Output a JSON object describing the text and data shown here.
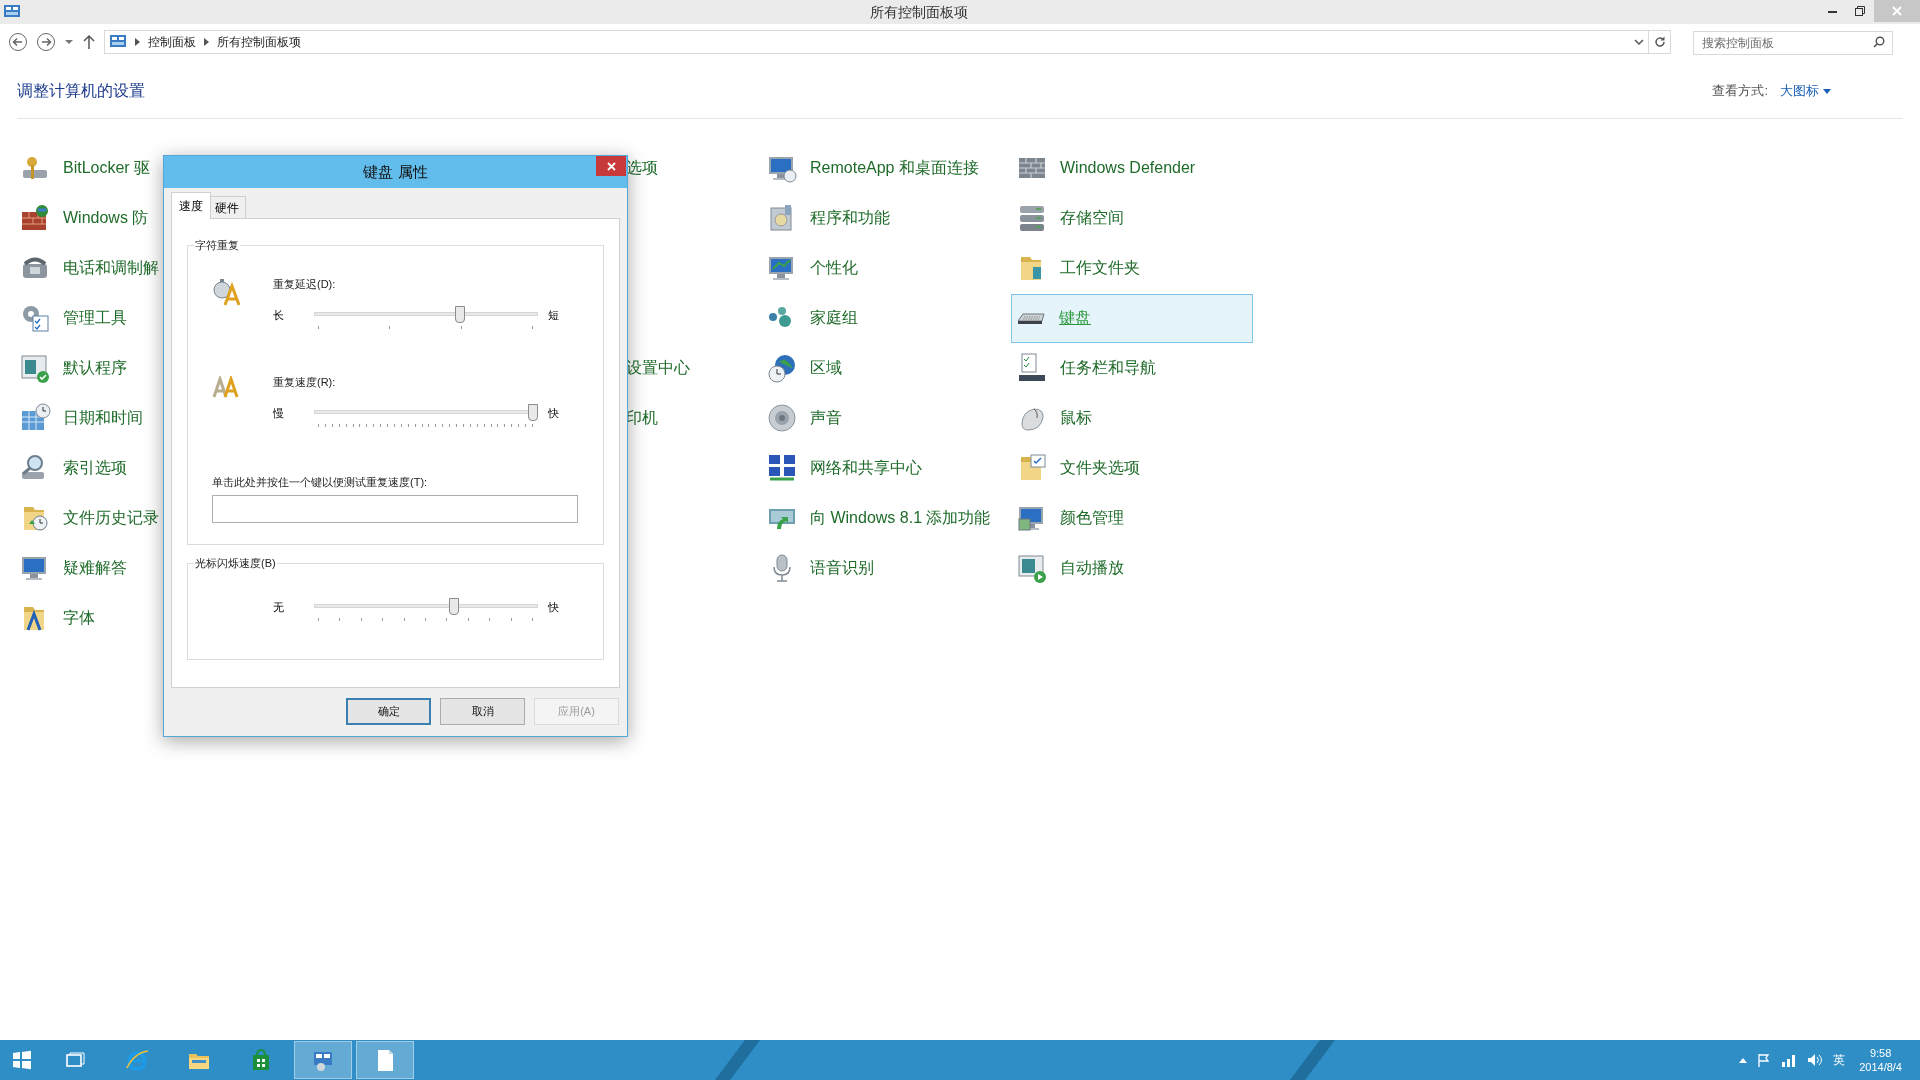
{
  "window": {
    "title": "所有控制面板项"
  },
  "address_bar": {
    "breadcrumbs": [
      "控制面板",
      "所有控制面板项"
    ]
  },
  "search": {
    "placeholder": "搜索控制面板"
  },
  "header": {
    "title": "调整计算机的设置",
    "view_label": "查看方式:",
    "view_value": "大图标"
  },
  "columns": [
    [
      {
        "label": "BitLocker 驱",
        "selected": false
      },
      {
        "label": "Windows 防",
        "selected": false
      },
      {
        "label": "电话和调制解",
        "selected": false
      },
      {
        "label": "管理工具",
        "selected": false
      },
      {
        "label": "默认程序",
        "selected": false
      },
      {
        "label": "日期和时间",
        "selected": false
      },
      {
        "label": "索引选项",
        "selected": false
      },
      {
        "label": "文件历史记录",
        "selected": false
      },
      {
        "label": "疑难解答",
        "selected": false
      },
      {
        "label": "字体",
        "selected": false
      }
    ],
    [
      {
        "label": "选项",
        "selected": false
      },
      null,
      null,
      null,
      {
        "label": "设置中心",
        "selected": false
      },
      {
        "label": "印机",
        "selected": false
      }
    ],
    [
      {
        "label": "RemoteApp 和桌面连接",
        "selected": false
      },
      {
        "label": "程序和功能",
        "selected": false
      },
      {
        "label": "个性化",
        "selected": false
      },
      {
        "label": "家庭组",
        "selected": false
      },
      {
        "label": "区域",
        "selected": false
      },
      {
        "label": "声音",
        "selected": false
      },
      {
        "label": "网络和共享中心",
        "selected": false
      },
      {
        "label": "向 Windows 8.1 添加功能",
        "selected": false
      },
      {
        "label": "语音识别",
        "selected": false
      }
    ],
    [
      {
        "label": "Windows Defender",
        "selected": false
      },
      {
        "label": "存储空间",
        "selected": false
      },
      {
        "label": "工作文件夹",
        "selected": false
      },
      {
        "label": "键盘",
        "selected": true
      },
      {
        "label": "任务栏和导航",
        "selected": false
      },
      {
        "label": "鼠标",
        "selected": false
      },
      {
        "label": "文件夹选项",
        "selected": false
      },
      {
        "label": "颜色管理",
        "selected": false
      },
      {
        "label": "自动播放",
        "selected": false
      }
    ]
  ],
  "dialog": {
    "title": "键盘 属性",
    "tabs": [
      {
        "label": "速度",
        "selected": true
      },
      {
        "label": "硬件",
        "selected": false
      }
    ],
    "groups": [
      {
        "title": "字符重复",
        "sliders": [
          {
            "label": "重复延迟(D):",
            "min_label": "长",
            "max_label": "短",
            "level": 0.66
          },
          {
            "label": "重复速度(R):",
            "min_label": "慢",
            "max_label": "快",
            "level": 1
          }
        ],
        "test_field": {
          "label": "单击此处并按住一个键以便测试重复速度(T):"
        }
      },
      {
        "title": "光标闪烁速度(B)",
        "sliders": [
          {
            "min_label": "无",
            "max_label": "快",
            "level": 0.63
          }
        ]
      }
    ],
    "buttons": [
      {
        "label": "确定",
        "default": true,
        "disabled": false
      },
      {
        "label": "取消",
        "default": false,
        "disabled": false
      },
      {
        "label": "应用(A)",
        "default": false,
        "disabled": true
      }
    ]
  },
  "taskbar": {
    "apps": [
      {
        "active": false
      },
      {
        "active": false
      },
      {
        "active": false
      },
      {
        "active": false
      },
      {
        "active": true
      },
      {
        "active": true
      }
    ],
    "tray": {
      "language": "英",
      "time": "9:58",
      "date": "2014/8/4"
    }
  }
}
